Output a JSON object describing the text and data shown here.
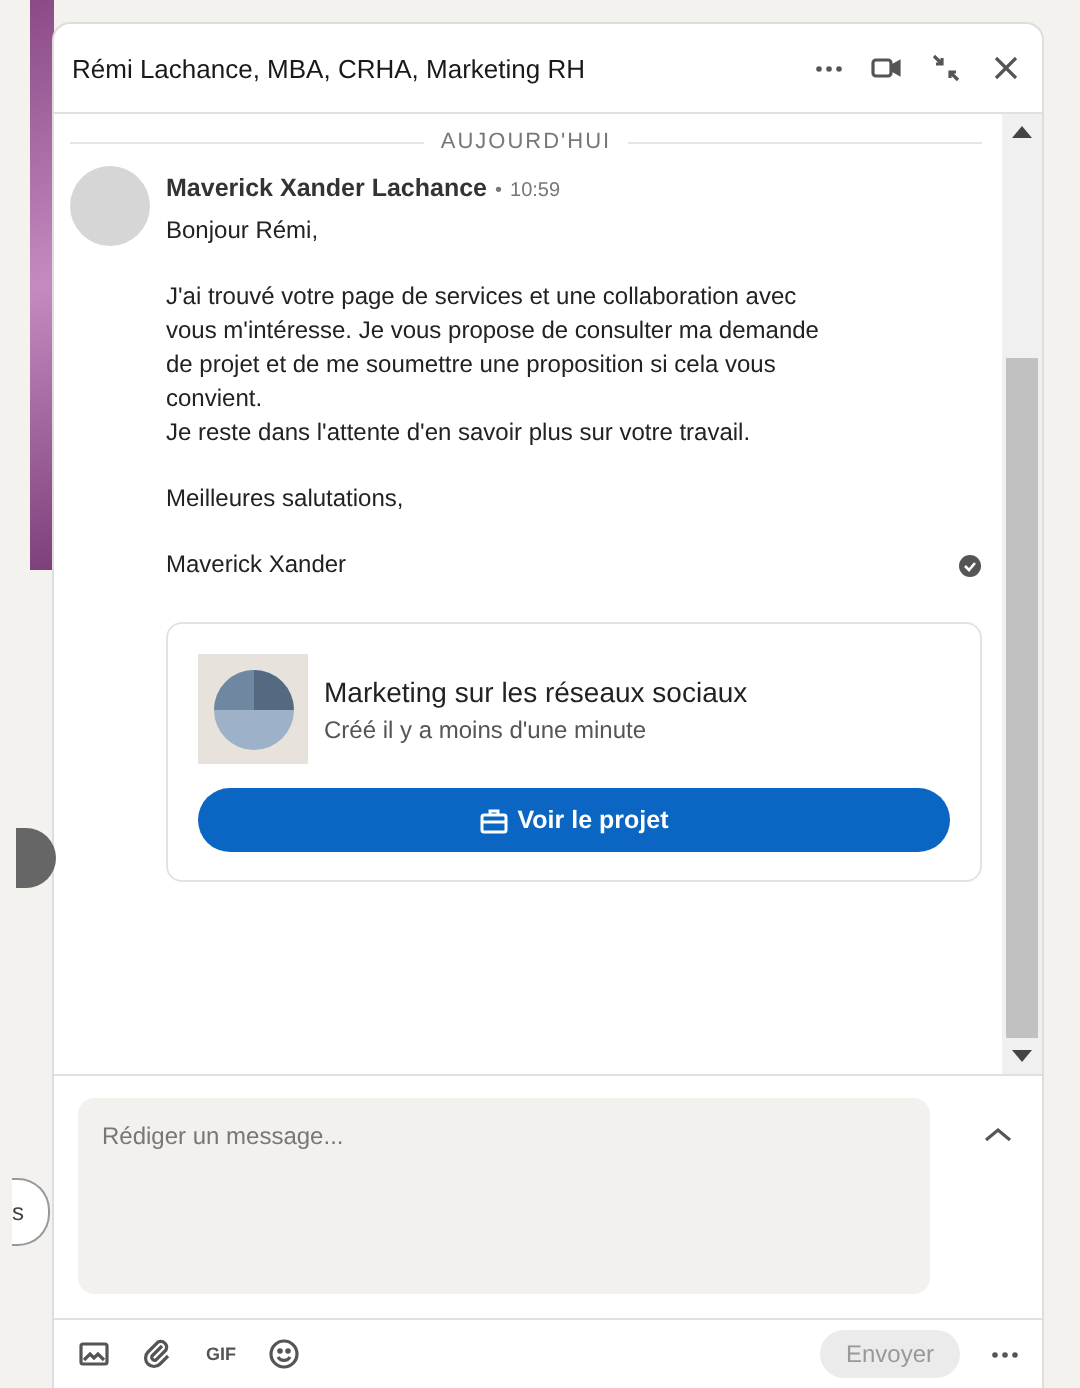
{
  "backdrop": {
    "pill_text": "s"
  },
  "window": {
    "title": "Rémi Lachance, MBA, CRHA, Marketing RH"
  },
  "divider_label": "AUJOURD'HUI",
  "message": {
    "sender": "Maverick Xander Lachance",
    "separator": "•",
    "time": "10:59",
    "read": true,
    "paragraphs": [
      "Bonjour Rémi,",
      "J'ai trouvé votre page de services et une collaboration avec vous m'intéresse. Je vous propose de consulter ma demande de projet et de me soumettre une proposition si cela vous convient.\nJe reste dans l'attente d'en savoir plus sur votre travail.",
      "Meilleures salutations,",
      "Maverick Xander"
    ]
  },
  "project_card": {
    "title": "Marketing sur les réseaux sociaux",
    "subtitle": "Créé il y a moins d'une minute",
    "button": "Voir le projet"
  },
  "composer": {
    "placeholder": "Rédiger un message...",
    "gif_label": "GIF",
    "send": "Envoyer",
    "send_disabled": true
  }
}
